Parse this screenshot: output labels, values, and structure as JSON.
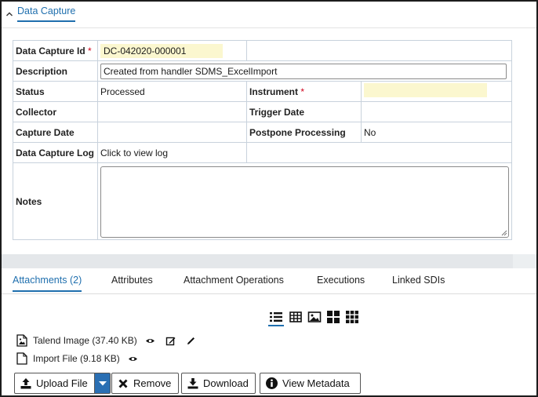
{
  "section": {
    "title": "Data Capture",
    "collapse_icon": "chevron-up-icon"
  },
  "form": {
    "data_capture_id": {
      "label": "Data Capture Id",
      "required_mark": "*",
      "value": "DC-042020-000001"
    },
    "description": {
      "label": "Description",
      "value": "Created from handler SDMS_ExcelImport"
    },
    "status": {
      "label": "Status",
      "value": "Processed"
    },
    "instrument": {
      "label": "Instrument",
      "required_mark": "*",
      "value": ""
    },
    "collector": {
      "label": "Collector",
      "value": ""
    },
    "trigger_date": {
      "label": "Trigger Date",
      "value": ""
    },
    "capture_date": {
      "label": "Capture Date",
      "value": ""
    },
    "postpone_processing": {
      "label": "Postpone Processing",
      "value": "No"
    },
    "data_capture_log": {
      "label": "Data Capture Log",
      "value": "Click to view log"
    },
    "notes": {
      "label": "Notes",
      "value": ""
    }
  },
  "colors": {
    "accent": "#1f6fae",
    "required": "#d0021b",
    "highlight_field": "#fbf7cf",
    "band": "#e4e7ea"
  },
  "tabs": [
    {
      "label": "Attachments (2)",
      "active": true
    },
    {
      "label": "Attributes",
      "active": false
    },
    {
      "label": "Attachment Operations",
      "active": false
    },
    {
      "label": "Executions",
      "active": false
    },
    {
      "label": "Linked SDIs",
      "active": false
    }
  ],
  "view_modes": [
    "list-view-icon",
    "table-view-icon",
    "image-view-icon",
    "large-grid-icon",
    "small-grid-icon"
  ],
  "attachments": [
    {
      "name": "Talend Image (37.40 KB)",
      "icon": "image-file-icon",
      "actions": [
        "view-eye-icon",
        "edit-icon",
        "pencil-icon"
      ]
    },
    {
      "name": "Import File (9.18 KB)",
      "icon": "document-file-icon",
      "actions": [
        "view-eye-icon"
      ]
    }
  ],
  "buttons": {
    "upload": "Upload File",
    "remove": "Remove",
    "download": "Download",
    "view_metadata": "View Metadata"
  }
}
